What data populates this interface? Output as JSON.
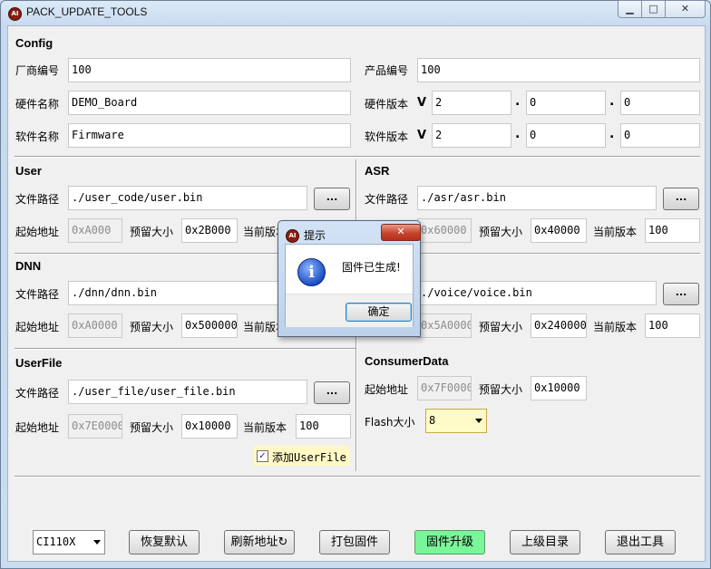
{
  "window": {
    "title": "PACK_UPDATE_TOOLS",
    "app_icon_text": "AI",
    "minimize": "▁",
    "maximize": "□",
    "close": "✕"
  },
  "config": {
    "heading": "Config",
    "vendor_label": "厂商编号",
    "vendor_value": "100",
    "product_label": "产品编号",
    "product_value": "100",
    "hw_name_label": "硬件名称",
    "hw_name_value": "DEMO_Board",
    "hw_version_label": "硬件版本",
    "hw_version": [
      "2",
      "0",
      "0"
    ],
    "sw_name_label": "软件名称",
    "sw_name_value": "Firmware",
    "sw_version_label": "软件版本",
    "sw_version": [
      "2",
      "0",
      "0"
    ],
    "v_mark": "V",
    "dot": "."
  },
  "user": {
    "heading": "User",
    "path_label": "文件路径",
    "path": "./user_code/user.bin",
    "browse": "...",
    "start_label": "起始地址",
    "start": "0xA000",
    "reserve_label": "预留大小",
    "reserve": "0x2B000",
    "cur_ver_label": "当前版本"
  },
  "asr": {
    "heading": "ASR",
    "path_label": "文件路径",
    "path": "./asr/asr.bin",
    "browse": "...",
    "start": "0x60000",
    "reserve_label": "预留大小",
    "reserve": "0x40000",
    "cur_ver_label": "当前版本",
    "cur_ver": "100"
  },
  "dnn": {
    "heading": "DNN",
    "path_label": "文件路径",
    "path": "./dnn/dnn.bin",
    "start_label": "起始地址",
    "start": "0xA0000",
    "reserve_label": "预留大小",
    "reserve": "0x500000",
    "cur_ver_label": "当前版本"
  },
  "voice": {
    "path": "./voice/voice.bin",
    "browse": "...",
    "start": "0x5A0000",
    "reserve_label": "预留大小",
    "reserve": "0x240000",
    "cur_ver_label": "当前版本",
    "cur_ver": "100"
  },
  "userfile": {
    "heading": "UserFile",
    "path_label": "文件路径",
    "path": "./user_file/user_file.bin",
    "browse": "...",
    "start_label": "起始地址",
    "start": "0x7E0000",
    "reserve_label": "预留大小",
    "reserve": "0x10000",
    "cur_ver_label": "当前版本",
    "cur_ver": "100",
    "add_label": "添加UserFile",
    "add_checked": true,
    "check_mark": "✓"
  },
  "consumer": {
    "heading": "ConsumerData",
    "start_label": "起始地址",
    "start": "0x7F0000",
    "reserve_label": "预留大小",
    "reserve": "0x10000",
    "flash_label": "Flash大小",
    "flash_value": "8"
  },
  "bottom": {
    "chip": "CI110X",
    "restore": "恢复默认",
    "refresh": "刷新地址",
    "refresh_icon": "↻",
    "pack": "打包固件",
    "upgrade": "固件升级",
    "parent": "上级目录",
    "exit": "退出工具"
  },
  "dialog": {
    "title": "提示",
    "icon": "i",
    "message": "固件已生成!",
    "ok": "确定",
    "close": "✕"
  }
}
